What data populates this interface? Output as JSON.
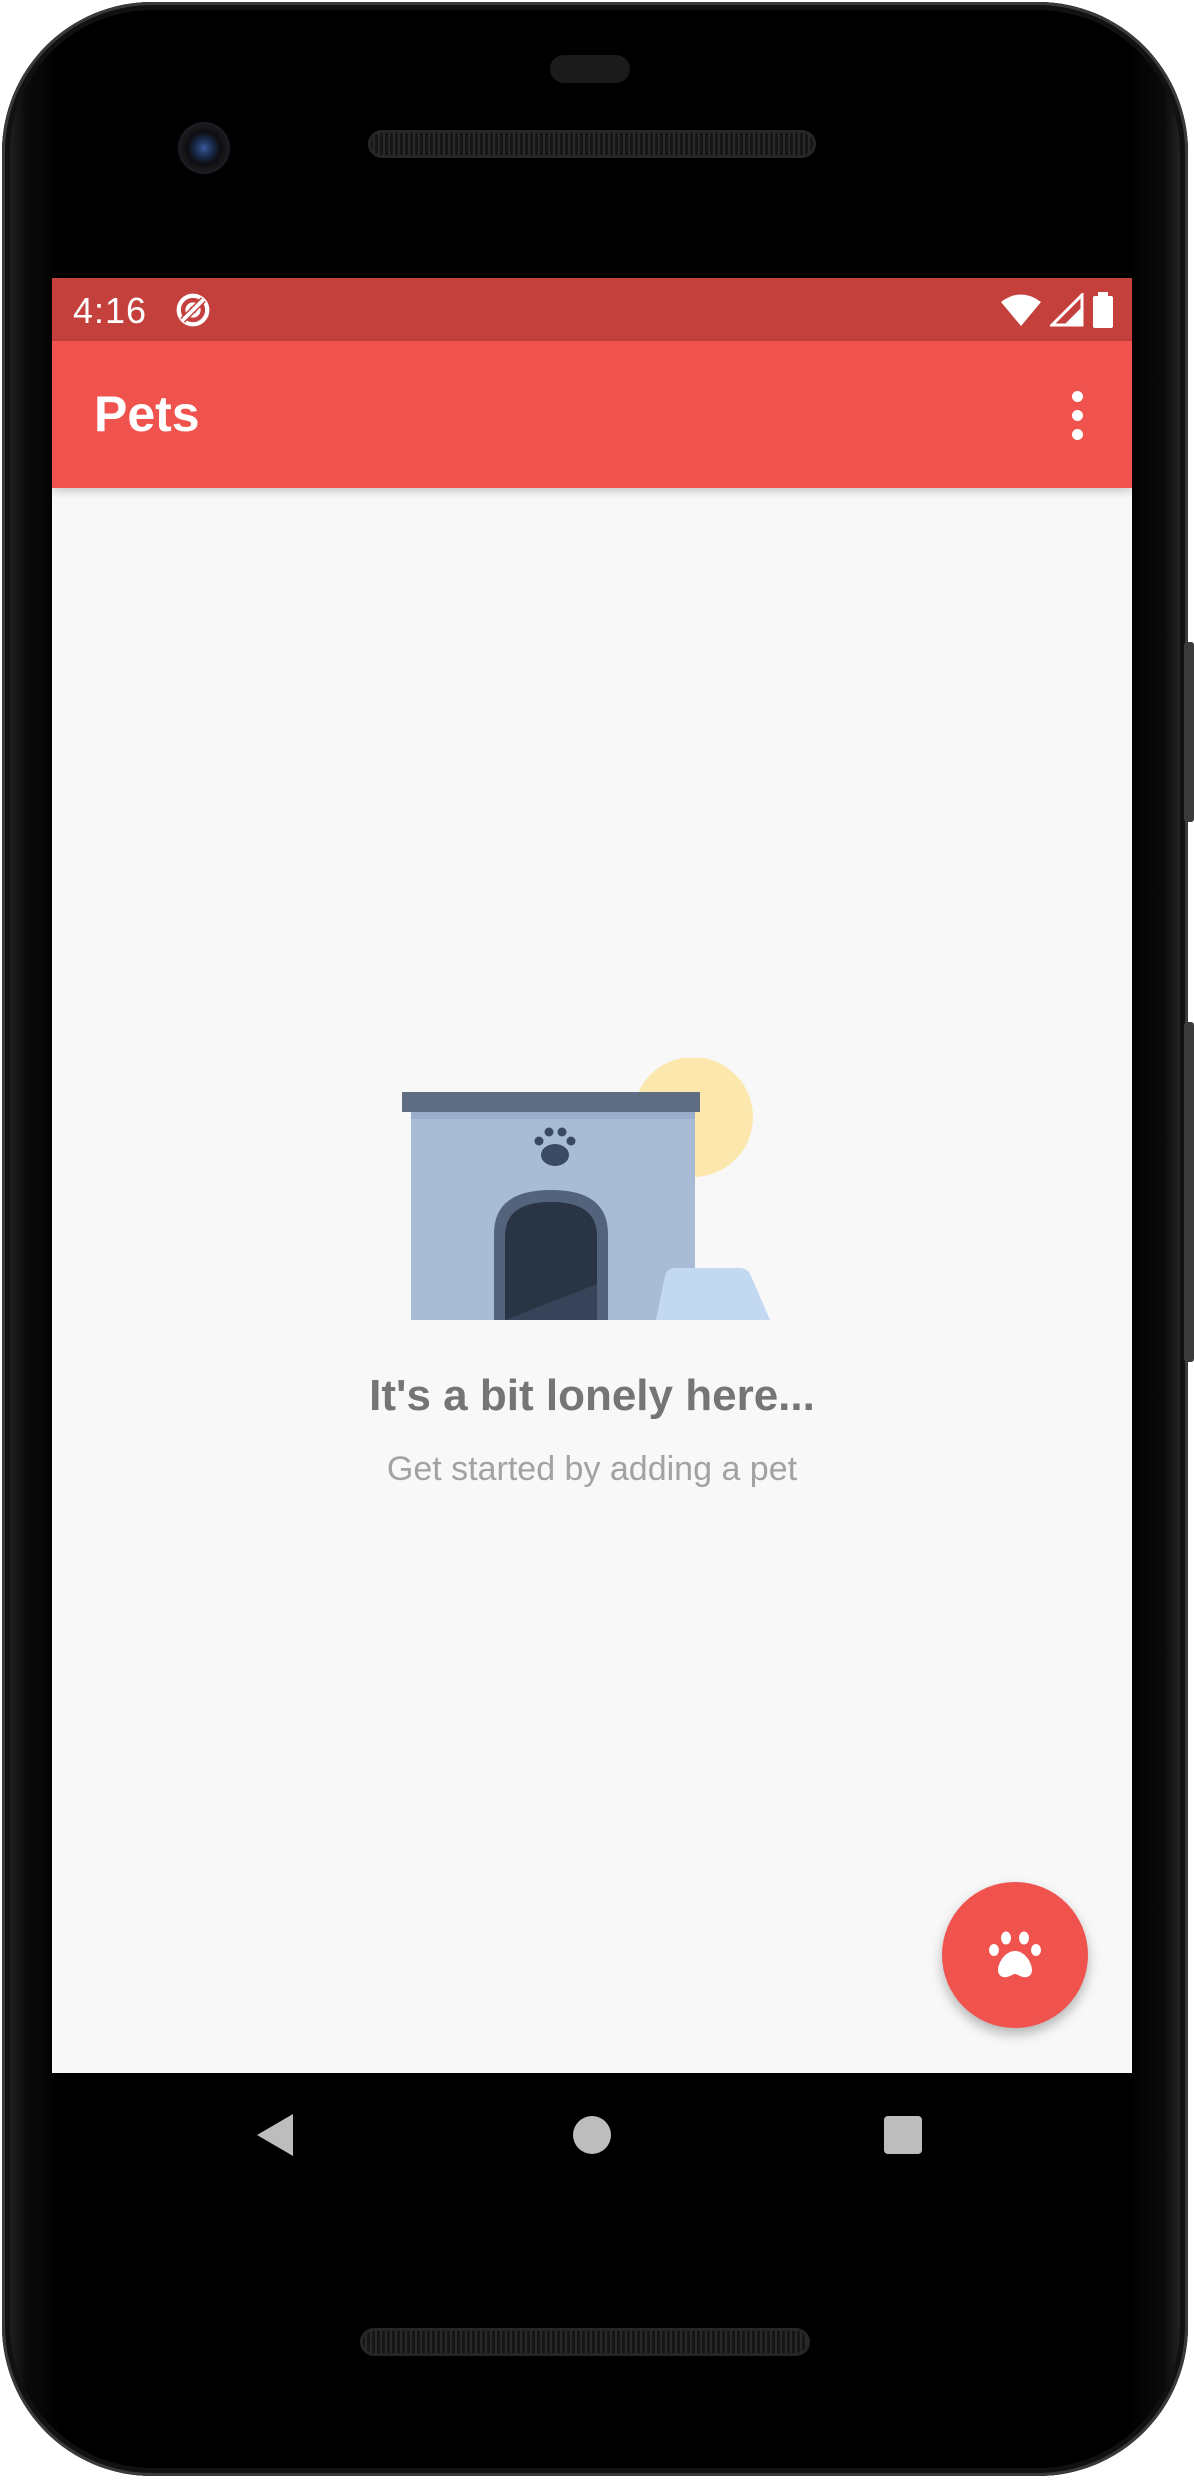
{
  "status_bar": {
    "time": "4:16",
    "icons": [
      "data-saver-icon",
      "wifi-icon",
      "signal-icon",
      "battery-icon"
    ]
  },
  "app_bar": {
    "title": "Pets",
    "overflow_icon": "more-vert-icon"
  },
  "empty_state": {
    "illustration": "dog-house-illustration",
    "title": "It's a bit lonely here...",
    "subtitle": "Get started by adding a pet"
  },
  "fab": {
    "icon": "paw-icon"
  },
  "nav_bar": {
    "buttons": [
      "back-icon",
      "home-icon",
      "recents-icon"
    ]
  },
  "colors": {
    "status_bar": "#c3403d",
    "app_bar": "#f0524d",
    "accent": "#f0524d",
    "background": "#f8f8f8",
    "title_text": "#757575",
    "subtitle_text": "#a2a2a2"
  }
}
